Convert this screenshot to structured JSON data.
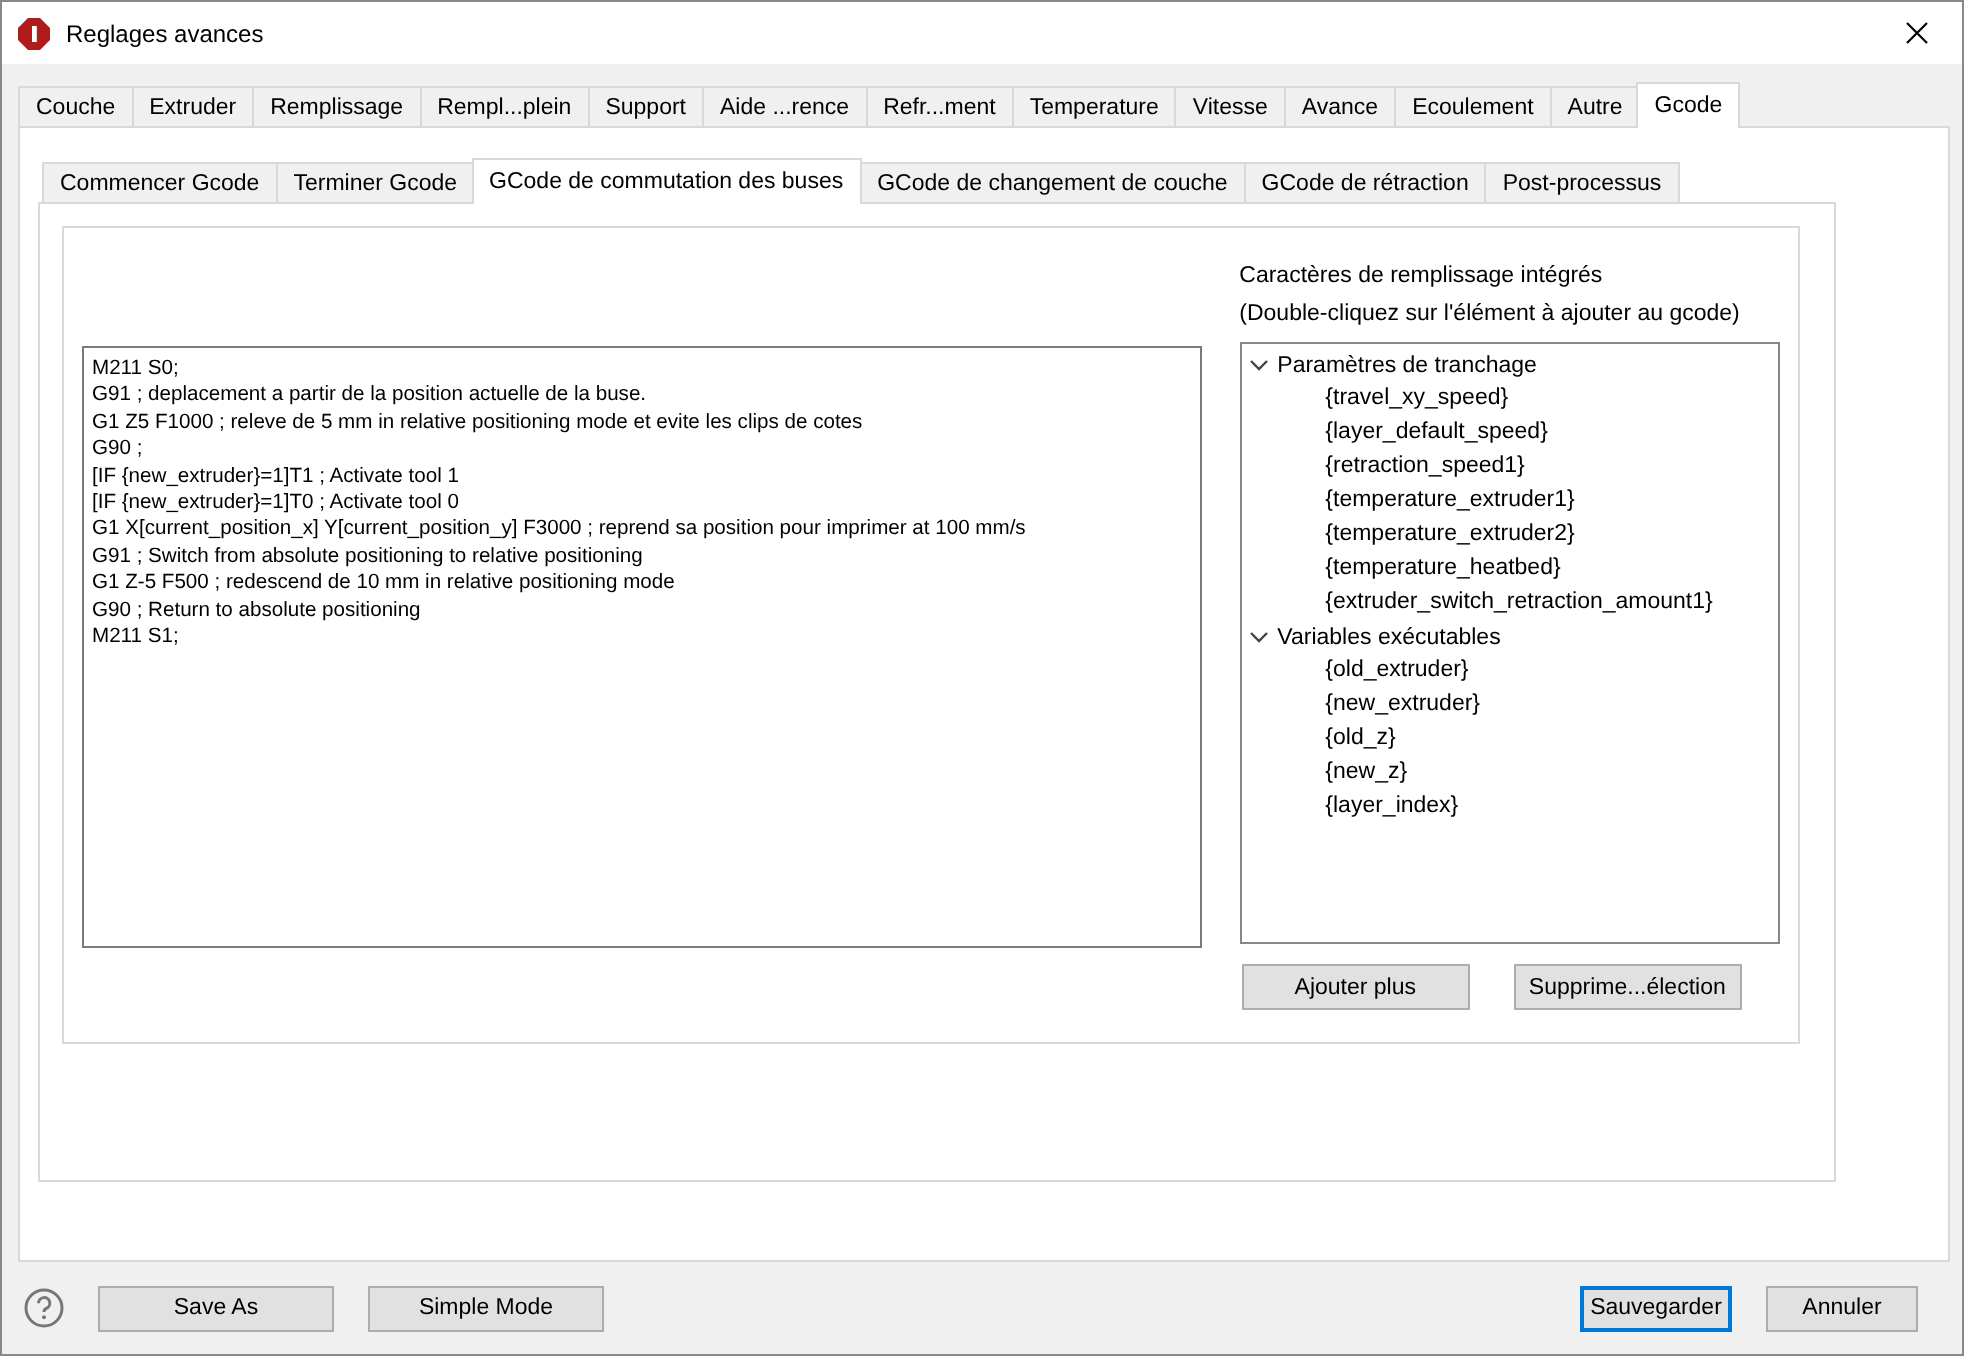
{
  "window": {
    "title": "Reglages avances"
  },
  "tabs": [
    {
      "label": "Couche",
      "selected": false
    },
    {
      "label": "Extruder",
      "selected": false
    },
    {
      "label": "Remplissage",
      "selected": false
    },
    {
      "label": "Rempl...plein",
      "selected": false
    },
    {
      "label": "Support",
      "selected": false
    },
    {
      "label": "Aide ...rence",
      "selected": false
    },
    {
      "label": "Refr...ment",
      "selected": false
    },
    {
      "label": "Temperature",
      "selected": false
    },
    {
      "label": "Vitesse",
      "selected": false
    },
    {
      "label": "Avance",
      "selected": false
    },
    {
      "label": "Ecoulement",
      "selected": false
    },
    {
      "label": "Autre",
      "selected": false
    },
    {
      "label": "Gcode",
      "selected": true
    }
  ],
  "subtabs": [
    {
      "label": "Commencer Gcode",
      "selected": false
    },
    {
      "label": "Terminer Gcode",
      "selected": false
    },
    {
      "label": "GCode de commutation des buses",
      "selected": true
    },
    {
      "label": "GCode de changement de couche",
      "selected": false
    },
    {
      "label": "GCode de rétraction",
      "selected": false
    },
    {
      "label": "Post-processus",
      "selected": false
    }
  ],
  "editor": {
    "lines": [
      "M211 S0;",
      "G91 ; deplacement a partir de la position actuelle de la buse.",
      "G1 Z5 F1000 ; releve de 5 mm in relative positioning mode et evite les clips de cotes",
      "G90 ;",
      "[IF {new_extruder}=1]T1 ; Activate tool 1",
      "[IF {new_extruder}=1]T0 ; Activate tool 0",
      "G1 X[current_position_x] Y[current_position_y] F3000 ; reprend sa position pour imprimer at 100 mm/s",
      "G91 ; Switch from absolute positioning to relative positioning",
      "G1 Z-5 F500 ; redescend de 10 mm in relative positioning mode",
      "G90 ; Return to absolute positioning",
      "M211 S1;"
    ]
  },
  "placeholders": {
    "title": "Caractères de remplissage intégrés",
    "hint": "(Double-cliquez sur l'élément à ajouter au gcode)",
    "tree": [
      {
        "label": "Paramètres de tranchage",
        "expanded": true,
        "children": [
          {
            "label": "{travel_xy_speed}"
          },
          {
            "label": "{layer_default_speed}"
          },
          {
            "label": "{retraction_speed1}"
          },
          {
            "label": "{temperature_extruder1}"
          },
          {
            "label": "{temperature_extruder2}"
          },
          {
            "label": "{temperature_heatbed}"
          },
          {
            "label": "{extruder_switch_retraction_amount1}"
          }
        ]
      },
      {
        "label": "Variables exécutables",
        "expanded": true,
        "children": [
          {
            "label": "{old_extruder}"
          },
          {
            "label": "{new_extruder}"
          },
          {
            "label": "{old_z}"
          },
          {
            "label": "{new_z}"
          },
          {
            "label": "{layer_index}"
          }
        ]
      }
    ],
    "buttons": [
      "Ajouter plus",
      "Supprime...élection"
    ]
  },
  "footer": {
    "left_buttons": [
      "Save As",
      "Simple Mode"
    ],
    "right_buttons": [
      {
        "label": "Sauvegarder",
        "default": true
      },
      {
        "label": "Annuler",
        "default": false
      }
    ]
  }
}
